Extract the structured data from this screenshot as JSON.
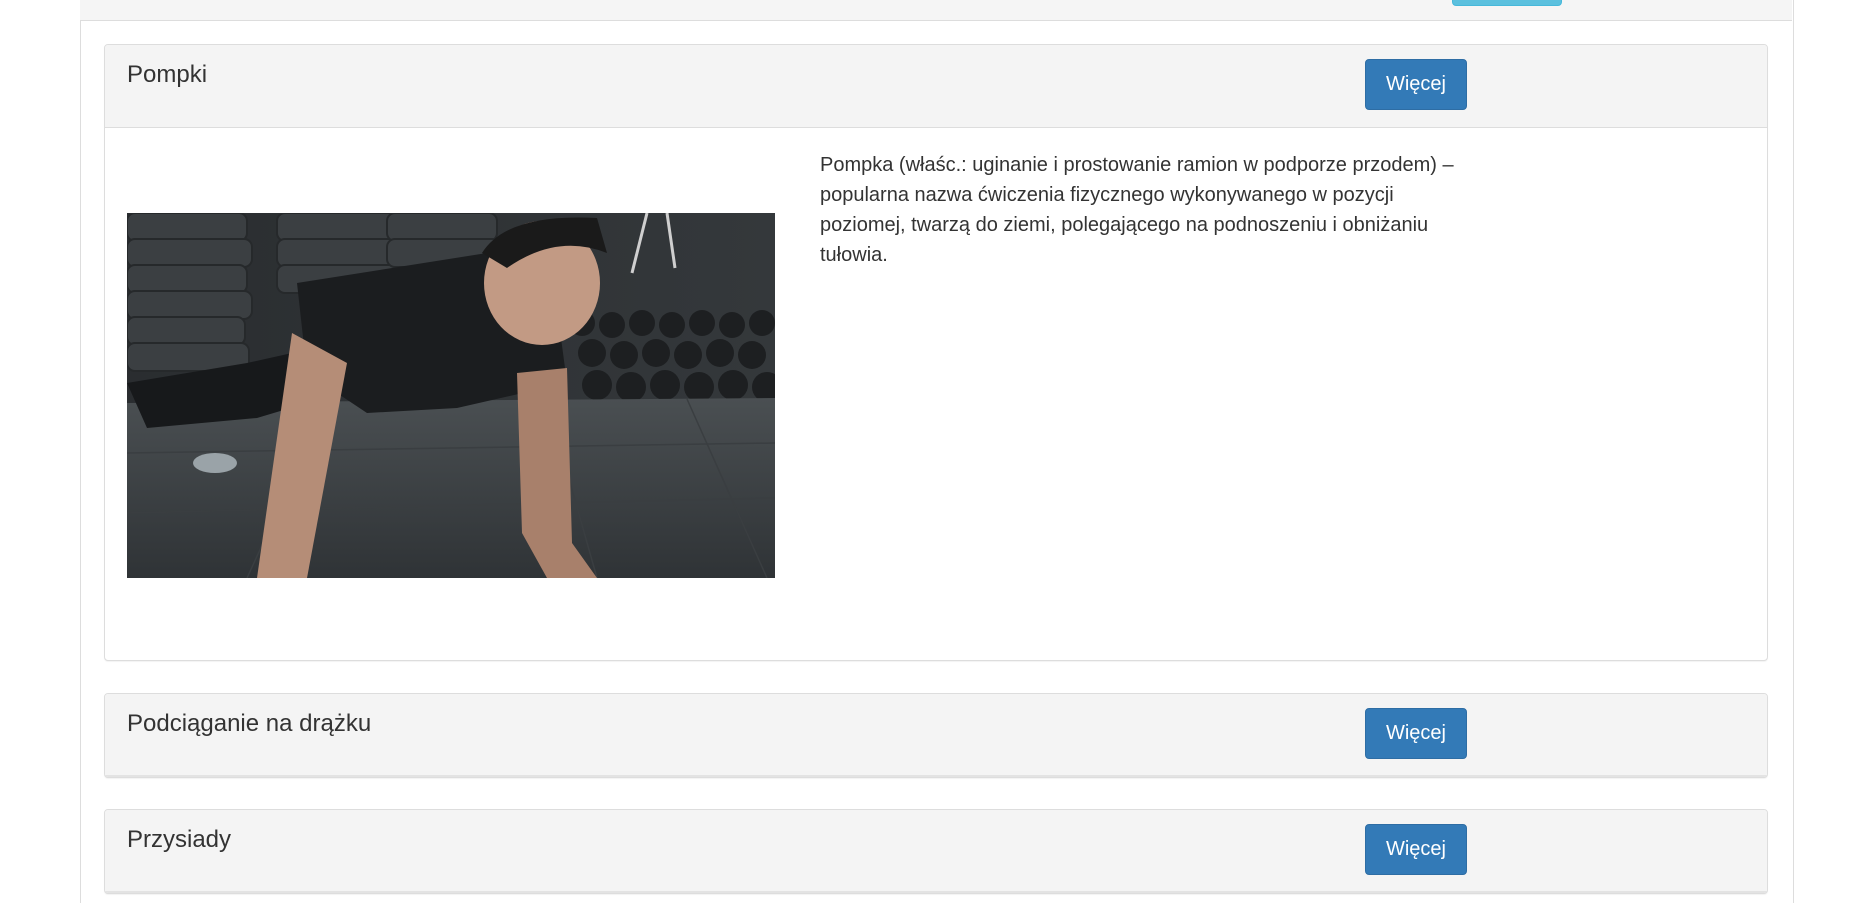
{
  "panels": [
    {
      "title": "Pompki",
      "button_label": "Więcej",
      "image_alt": "pushup-photo",
      "description": "Pompka (właśc.: uginanie i prostowanie ramion w podporze przodem) – popularna nazwa ćwiczenia fizycznego wykonywanego w pozycji poziomej, twarzą do ziemi, polegającego na podnoszeniu i obniżaniu tułowia."
    },
    {
      "title": "Podciąganie na drążku",
      "button_label": "Więcej"
    },
    {
      "title": "Przysiady",
      "button_label": "Więcej"
    }
  ],
  "colors": {
    "primary_button": "#337ab7",
    "info_button": "#5bc0de",
    "panel_heading": "#f4f4f4"
  }
}
